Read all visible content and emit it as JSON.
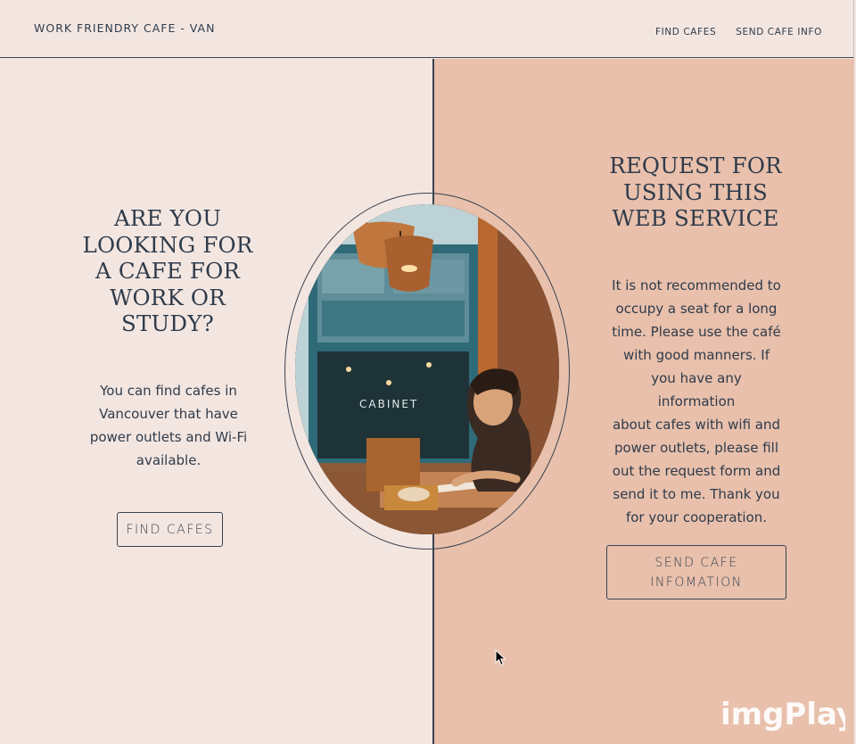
{
  "header": {
    "brand": "WORK FRIENDRY CAFE - VAN",
    "nav": [
      "FIND CAFES",
      "SEND CAFE INFO"
    ]
  },
  "left": {
    "heading": [
      "ARE YOU",
      "LOOKING FOR",
      "A CAFE FOR",
      "WORK OR",
      "STUDY?"
    ],
    "body": [
      "You can find cafes in",
      "Vancouver that have",
      "power outlets and Wi-Fi",
      "available."
    ],
    "button": "FIND CAFES"
  },
  "right": {
    "heading": [
      "REQUEST FOR",
      "USING THIS",
      "WEB SERVICE"
    ],
    "body": [
      "It is not recommended to",
      "occupy a seat for a long",
      "time. Please use the café",
      "with good manners. If",
      "you have any information",
      "about cafes with wifi and",
      "power outlets, please fill",
      "out the request form and",
      "send it to me. Thank you",
      "for your cooperation."
    ],
    "button": [
      "SEND CAFE",
      "INFOMATION"
    ]
  },
  "photo": {
    "sign_text": "CABINET"
  },
  "watermark": "imgPlay",
  "colors": {
    "background": "#f3e6e1",
    "right_panel": "#e8c0ac",
    "ink": "#2f3b4a"
  },
  "icons": [
    "cursor-arrow-icon"
  ]
}
